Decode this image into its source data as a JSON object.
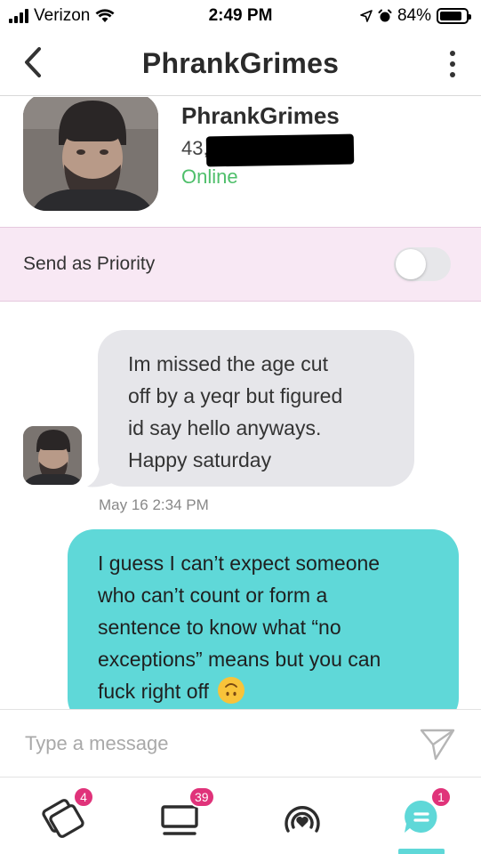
{
  "status_bar": {
    "carrier": "Verizon",
    "time": "2:49 PM",
    "battery_percent": "84%",
    "battery_level": 0.84
  },
  "header": {
    "title": "PhrankGrimes"
  },
  "profile": {
    "name": "PhrankGrimes",
    "age": "43,",
    "status": "Online"
  },
  "priority": {
    "label": "Send as Priority",
    "enabled": false
  },
  "messages": [
    {
      "direction": "incoming",
      "lines": [
        "Im missed the age cut",
        "off by a yeqr but figured",
        "id say hello anyways.",
        "Happy saturday"
      ],
      "timestamp": "May 16 2:34 PM"
    },
    {
      "direction": "outgoing",
      "lines": [
        "I guess I can’t expect someone",
        "who can’t count or form a",
        "sentence to know what “no",
        "exceptions” means but you can",
        "fuck right off"
      ],
      "emoji": "upside-down-face"
    }
  ],
  "composer": {
    "placeholder": "Type a message"
  },
  "tabbar": {
    "tabs": [
      {
        "icon": "cards-icon",
        "badge": "4"
      },
      {
        "icon": "stack-icon",
        "badge": "39"
      },
      {
        "icon": "broadcast-heart-icon",
        "badge": ""
      },
      {
        "icon": "chat-icon",
        "badge": "1"
      }
    ]
  },
  "colors": {
    "accent_teal": "#5fd8d8",
    "badge_pink": "#e0337a",
    "online_green": "#4fbf6b",
    "priority_bg": "#f8e8f4"
  }
}
